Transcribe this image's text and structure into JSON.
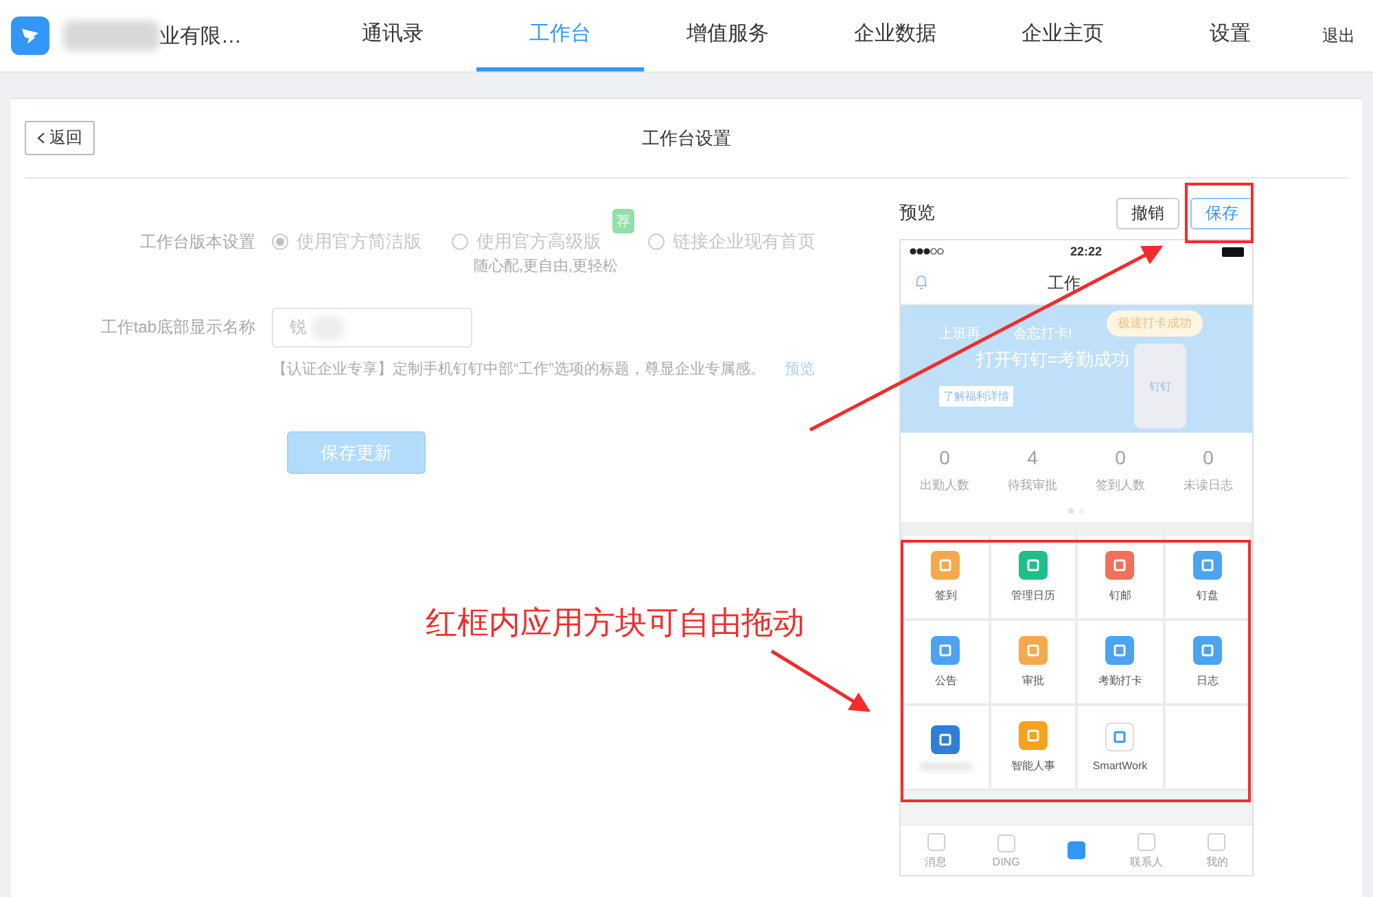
{
  "header": {
    "company": "业有限…",
    "nav": [
      {
        "label": "通讯录",
        "selected": false
      },
      {
        "label": "工作台",
        "selected": true
      },
      {
        "label": "增值服务",
        "selected": false
      },
      {
        "label": "企业数据",
        "selected": false
      },
      {
        "label": "企业主页",
        "selected": false
      },
      {
        "label": "设置",
        "selected": false
      }
    ],
    "logout": "退出"
  },
  "page": {
    "back": "返回",
    "title": "工作台设置"
  },
  "form": {
    "version_label": "工作台版本设置",
    "options": [
      {
        "label": "使用官方简洁版",
        "selected": true
      },
      {
        "label": "使用官方高级版",
        "selected": false,
        "badge": "荐",
        "hint": "随心配,更自由,更轻松"
      },
      {
        "label": "链接企业现有首页",
        "selected": false
      }
    ],
    "name_label": "工作tab底部显示名称",
    "name_value": "锐",
    "hint": "【认证企业专享】定制手机钉钉中部“工作”选项的标题，尊显企业专属感。",
    "hint_link": "预览",
    "submit": "保存更新"
  },
  "preview": {
    "title": "预览",
    "cancel": "撤销",
    "save": "保存",
    "phone": {
      "time": "22:22",
      "title": "工作",
      "banner": {
        "line_1a": "上班再",
        "line_1b": "会忘打卡!",
        "line_2": "打开钉钉=考勤成功",
        "button": "了解福利详情",
        "bubble": "极速打卡成功",
        "brand": "钉钉"
      },
      "stats": [
        {
          "value": "0",
          "label": "出勤人数"
        },
        {
          "value": "4",
          "label": "待我审批"
        },
        {
          "value": "0",
          "label": "签到人数"
        },
        {
          "value": "0",
          "label": "未读日志"
        }
      ],
      "apps": [
        {
          "label": "签到",
          "color": "#f5a94d"
        },
        {
          "label": "管理日历",
          "color": "#1fbf8a"
        },
        {
          "label": "钉邮",
          "color": "#f0705a"
        },
        {
          "label": "钉盘",
          "color": "#4da3ee"
        },
        {
          "label": "公告",
          "color": "#4da3ee"
        },
        {
          "label": "审批",
          "color": "#f5a94d"
        },
        {
          "label": "考勤打卡",
          "color": "#4da3ee"
        },
        {
          "label": "日志",
          "color": "#4da3ee"
        },
        {
          "color": "#2f7fd8"
        },
        {
          "label": "智能人事",
          "color": "#f7a21d"
        },
        {
          "label": "SmartWork",
          "color": "#ffffff"
        }
      ],
      "tabs": [
        {
          "label": "消息",
          "selected": false
        },
        {
          "label": "DING",
          "selected": false
        },
        {
          "selected": true
        },
        {
          "label": "联系人",
          "selected": false
        },
        {
          "label": "我的",
          "selected": false
        }
      ]
    }
  },
  "annotation": {
    "note": "红框内应用方块可自由拖动"
  }
}
